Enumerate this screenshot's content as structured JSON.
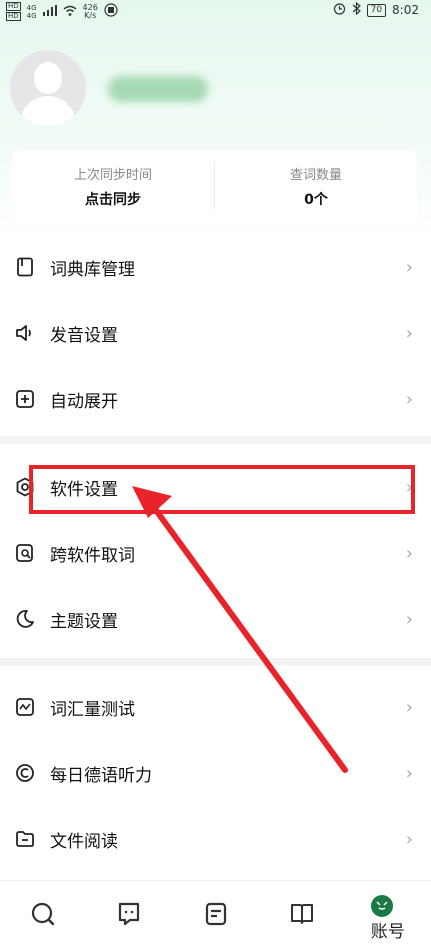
{
  "status_bar": {
    "net_speed_value": "426",
    "net_speed_unit": "K/s",
    "signal_1": "HD",
    "signal_2": "HD",
    "network_1": "4G",
    "network_2": "4G",
    "battery": "70",
    "time": "8:02"
  },
  "stats": {
    "sync_label": "上次同步时间",
    "sync_value": "点击同步",
    "lookup_label": "查词数量",
    "lookup_value": "0个"
  },
  "menu": {
    "group1": [
      {
        "label": "词典库管理",
        "icon": "dictionary-icon"
      },
      {
        "label": "发音设置",
        "icon": "speaker-icon"
      },
      {
        "label": "自动展开",
        "icon": "plus-square-icon"
      }
    ],
    "group2": [
      {
        "label": "软件设置",
        "icon": "gear-icon"
      },
      {
        "label": "跨软件取词",
        "icon": "search-doc-icon"
      },
      {
        "label": "主题设置",
        "icon": "moon-icon"
      }
    ],
    "group3": [
      {
        "label": "词汇量测试",
        "icon": "chart-icon"
      },
      {
        "label": "每日德语听力",
        "icon": "audio-circle-icon"
      },
      {
        "label": "文件阅读",
        "icon": "folder-icon"
      }
    ]
  },
  "bottom_nav": {
    "account_label": "账号"
  },
  "colors": {
    "accent": "#1a7a45",
    "annotation": "#e8232a"
  }
}
